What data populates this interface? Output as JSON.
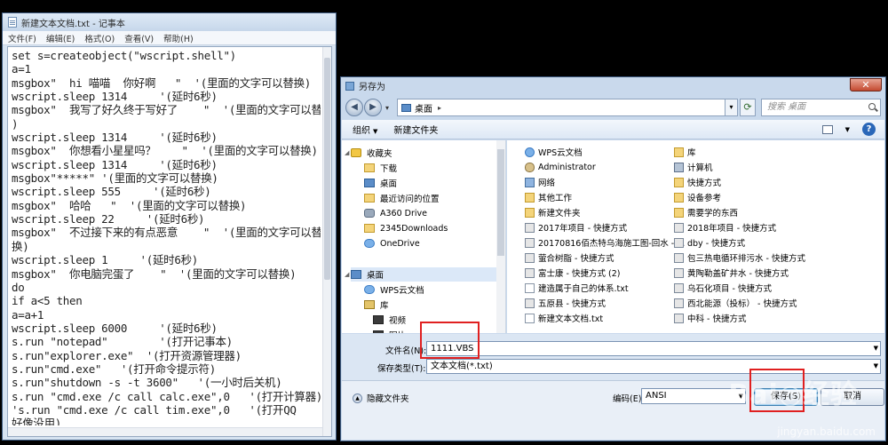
{
  "notepad": {
    "title": "新建文本文档.txt - 记事本",
    "menu": [
      "文件(F)",
      "编辑(E)",
      "格式(O)",
      "查看(V)",
      "帮助(H)"
    ],
    "lines": [
      "set s=createobject(\"wscript.shell\")",
      "a=1",
      "msgbox\"  hi 喵喵  你好啊   \"  '(里面的文字可以替换)",
      "wscript.sleep 1314     '(延时6秒)",
      "msgbox\"  我写了好久终于写好了    \"  '(里面的文字可以替换",
      ")",
      "wscript.sleep 1314     '(延时6秒)",
      "msgbox\"  你想看小星星吗？    \"  '(里面的文字可以替换)",
      "wscript.sleep 1314     '(延时6秒)",
      "msgbox\"*****\" '(里面的文字可以替换)",
      "wscript.sleep 555     '(延时6秒)",
      "msgbox\"  哈哈   \"  '(里面的文字可以替换)",
      "wscript.sleep 22     '(延时6秒)",
      "msgbox\"  不过接下来的有点恶意    \"  '(里面的文字可以替",
      "换)",
      "wscript.sleep 1     '(延时6秒)",
      "msgbox\"  你电脑完蛋了    \"  '(里面的文字可以替换)",
      "do",
      "if a<5 then",
      "a=a+1",
      "wscript.sleep 6000     '(延时6秒)",
      "s.run \"notepad\"        '(打开记事本)",
      "s.run\"explorer.exe\"  '(打开资源管理器)",
      "s.run\"cmd.exe\"   '(打开命令提示符)",
      "s.run\"shutdown -s -t 3600\"   '(一小时后关机)",
      "s.run \"cmd.exe /c call calc.exe\",0   '(打开计算器)",
      "'s.run \"cmd.exe /c call tim.exe\",0   '(打开QQ",
      "好像没用)"
    ]
  },
  "dialog": {
    "title": "另存为",
    "close_label": "✕",
    "address": "桌面",
    "search_placeholder": "搜索 桌面",
    "toolbar": {
      "organize": "组织",
      "new_folder": "新建文件夹"
    },
    "nav": {
      "favorites": "收藏夹",
      "fav_items": [
        "下载",
        "桌面",
        "最近访问的位置",
        "A360 Drive",
        "2345Downloads",
        "OneDrive"
      ],
      "desktop": "桌面",
      "desk_items": [
        "WPS云文档",
        "库",
        "视频",
        "图片"
      ]
    },
    "files_left": [
      "WPS云文档",
      "Administrator",
      "网络",
      "其他工作",
      "新建文件夹",
      "2017年项目 - 快捷方式",
      "20170816佰杰特乌海施工图-回水 - ...",
      "萤合树脂 - 快捷方式",
      "富士康 - 快捷方式 (2)",
      "建造属于自己的体系.txt",
      "五原县 - 快捷方式",
      "新建文本文档.txt"
    ],
    "files_right": [
      "库",
      "计算机",
      "快捷方式",
      "设备参考",
      "需要学的东西",
      "2018年项目 - 快捷方式",
      "dby - 快捷方式",
      "包三热电循环排污水 - 快捷方式",
      "黄陶勒盖矿井水 - 快捷方式",
      "乌石化项目 - 快捷方式",
      "西北能源（投标） - 快捷方式",
      "中科 - 快捷方式"
    ],
    "filename_label": "文件名(N):",
    "filename_value": "1111.VBS",
    "filetype_label": "保存类型(T):",
    "filetype_value": "文本文档(*.txt)",
    "hide_folders": "隐藏文件夹",
    "encoding_label": "编码(E):",
    "encoding_value": "ANSI",
    "save_label": "保存(S)",
    "cancel_label": "取消"
  },
  "watermark": {
    "logo": "Bai◎经验",
    "url": "jingyan.baidu.com"
  }
}
